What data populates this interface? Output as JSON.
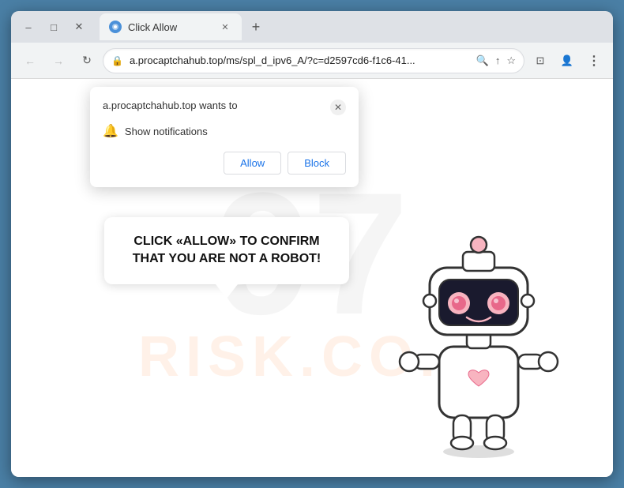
{
  "window": {
    "title": "Click Allow",
    "favicon": "C"
  },
  "titlebar": {
    "minimize_title": "Minimize",
    "maximize_title": "Maximize",
    "close_title": "Close",
    "min_icon": "–",
    "max_icon": "□",
    "close_icon": "✕"
  },
  "toolbar": {
    "back_icon": "←",
    "forward_icon": "→",
    "refresh_icon": "↻",
    "url": "a.procaptchahub.top/ms/spl_d_ipv6_A/?c=d2597cd6-f1c6-41...",
    "search_icon": "🔍",
    "share_icon": "↑",
    "bookmark_icon": "☆",
    "extensions_icon": "⊡",
    "profile_icon": "👤",
    "menu_icon": "⋮"
  },
  "popup": {
    "site_text": "a.procaptchahub.top wants to",
    "permission_text": "Show notifications",
    "allow_label": "Allow",
    "block_label": "Block",
    "close_icon": "✕"
  },
  "bubble": {
    "text": "CLICK «ALLOW» TO CONFIRM THAT YOU ARE NOT A ROBOT!"
  },
  "watermark": {
    "number": "97",
    "text": "RISK.CO..."
  }
}
